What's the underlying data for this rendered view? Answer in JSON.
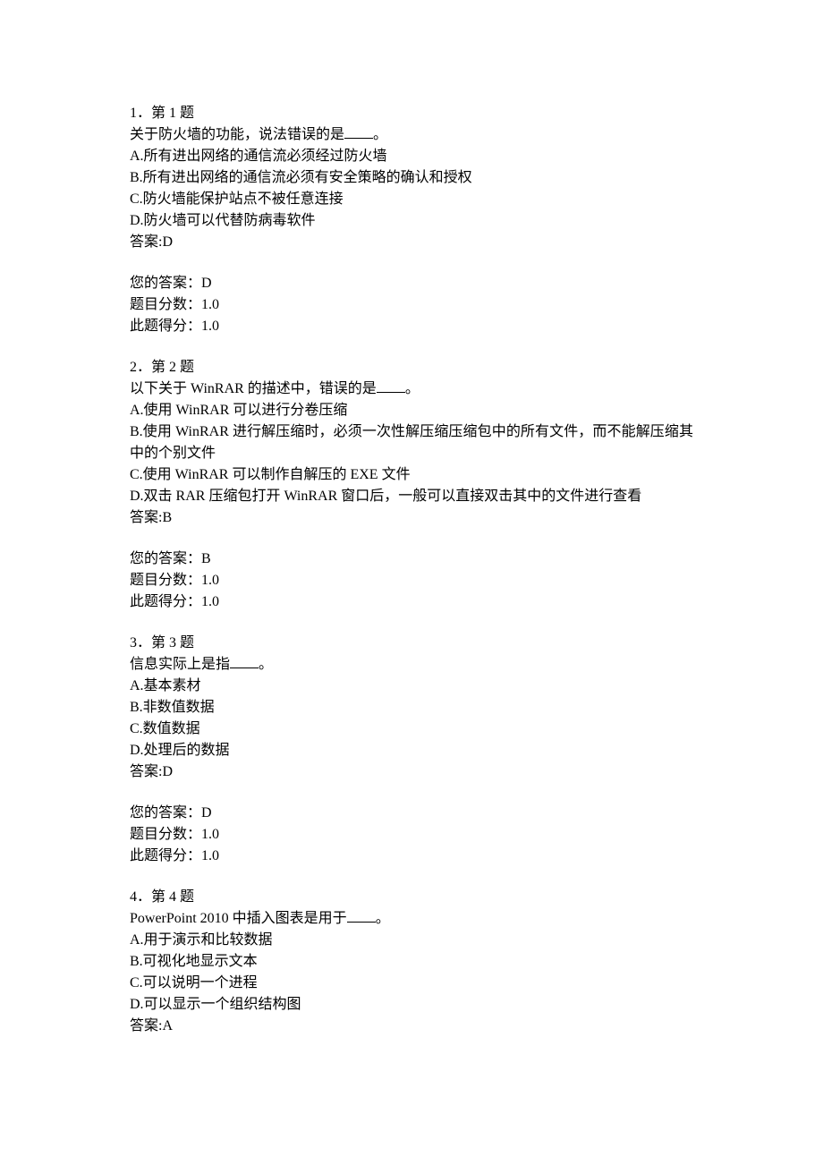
{
  "questions": [
    {
      "number": "1．第 1 题",
      "stem_prefix": "关于防火墙的功能，说法错误的是",
      "stem_suffix": "。",
      "options": [
        "A.所有进出网络的通信流必须经过防火墙",
        "B.所有进出网络的通信流必须有安全策略的确认和授权",
        "C.防火墙能保护站点不被任意连接",
        "D.防火墙可以代替防病毒软件"
      ],
      "answer_label": "答案:D",
      "user_answer": "您的答案：D",
      "total_score": "题目分数：1.0",
      "earned_score": "此题得分：1.0"
    },
    {
      "number": "2．第 2 题",
      "stem_prefix": "以下关于 WinRAR 的描述中，错误的是",
      "stem_suffix": "。",
      "options": [
        "A.使用 WinRAR 可以进行分卷压缩",
        "B.使用 WinRAR 进行解压缩时，必须一次性解压缩压缩包中的所有文件，而不能解压缩其中的个别文件",
        "C.使用 WinRAR 可以制作自解压的 EXE 文件",
        "D.双击 RAR 压缩包打开 WinRAR 窗口后，一般可以直接双击其中的文件进行查看"
      ],
      "answer_label": "答案:B",
      "user_answer": "您的答案：B",
      "total_score": "题目分数：1.0",
      "earned_score": "此题得分：1.0"
    },
    {
      "number": "3．第 3 题",
      "stem_prefix": "信息实际上是指",
      "stem_suffix": "。",
      "options": [
        "A.基本素材",
        "B.非数值数据",
        "C.数值数据",
        "D.处理后的数据"
      ],
      "answer_label": "答案:D",
      "user_answer": "您的答案：D",
      "total_score": "题目分数：1.0",
      "earned_score": "此题得分：1.0"
    },
    {
      "number": "4．第 4 题",
      "stem_prefix": "PowerPoint 2010 中插入图表是用于",
      "stem_suffix": "。",
      "options": [
        "A.用于演示和比较数据",
        "B.可视化地显示文本",
        "C.可以说明一个进程",
        "D.可以显示一个组织结构图"
      ],
      "answer_label": "答案:A",
      "user_answer": "",
      "total_score": "",
      "earned_score": ""
    }
  ]
}
